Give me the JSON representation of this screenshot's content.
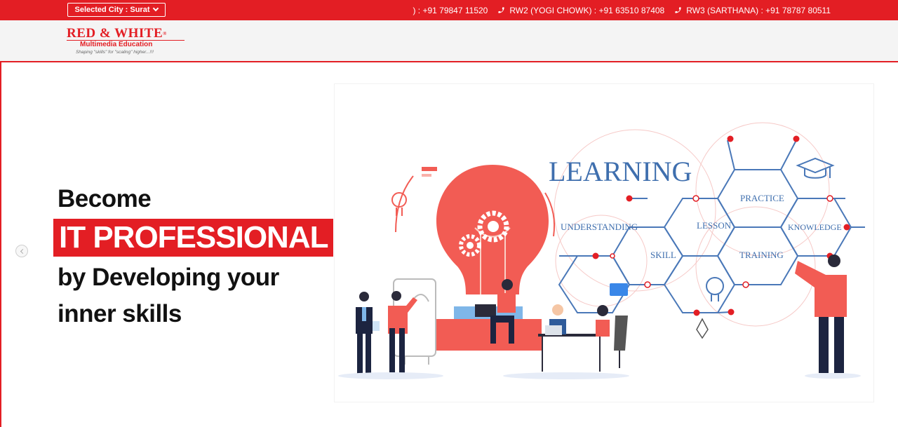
{
  "topbar": {
    "city_label": "Selected City : Surat",
    "contacts": [
      {
        "text": ") : +91 79847 11520",
        "icon": "none"
      },
      {
        "text": "RW2 (YOGI CHOWK) : +91 63510 87408",
        "icon": "phone-icon"
      },
      {
        "text": "RW3 (SARTHANA) : +91 78787 80511",
        "icon": "phone-icon"
      }
    ]
  },
  "logo": {
    "title": "RED & WHITE",
    "reg": "®",
    "subtitle": "Multimedia Education",
    "tagline": "Shaping \"skills\" for \"scaling\" higher...!!!"
  },
  "hero": {
    "line1": "Become",
    "line2": "IT PROFESSIONAL",
    "line3": "by Developing your",
    "line4": "inner skills"
  },
  "illustration": {
    "heading": "LEARNING",
    "nodes": [
      "PRACTICE",
      "UNDERSTANDING",
      "LESSON",
      "KNOWLEDGE",
      "SKILL",
      "TRAINING"
    ]
  },
  "colors": {
    "brand_red": "#e31e24",
    "hex_blue": "#4a78b8",
    "bulb_red": "#f25c54"
  }
}
